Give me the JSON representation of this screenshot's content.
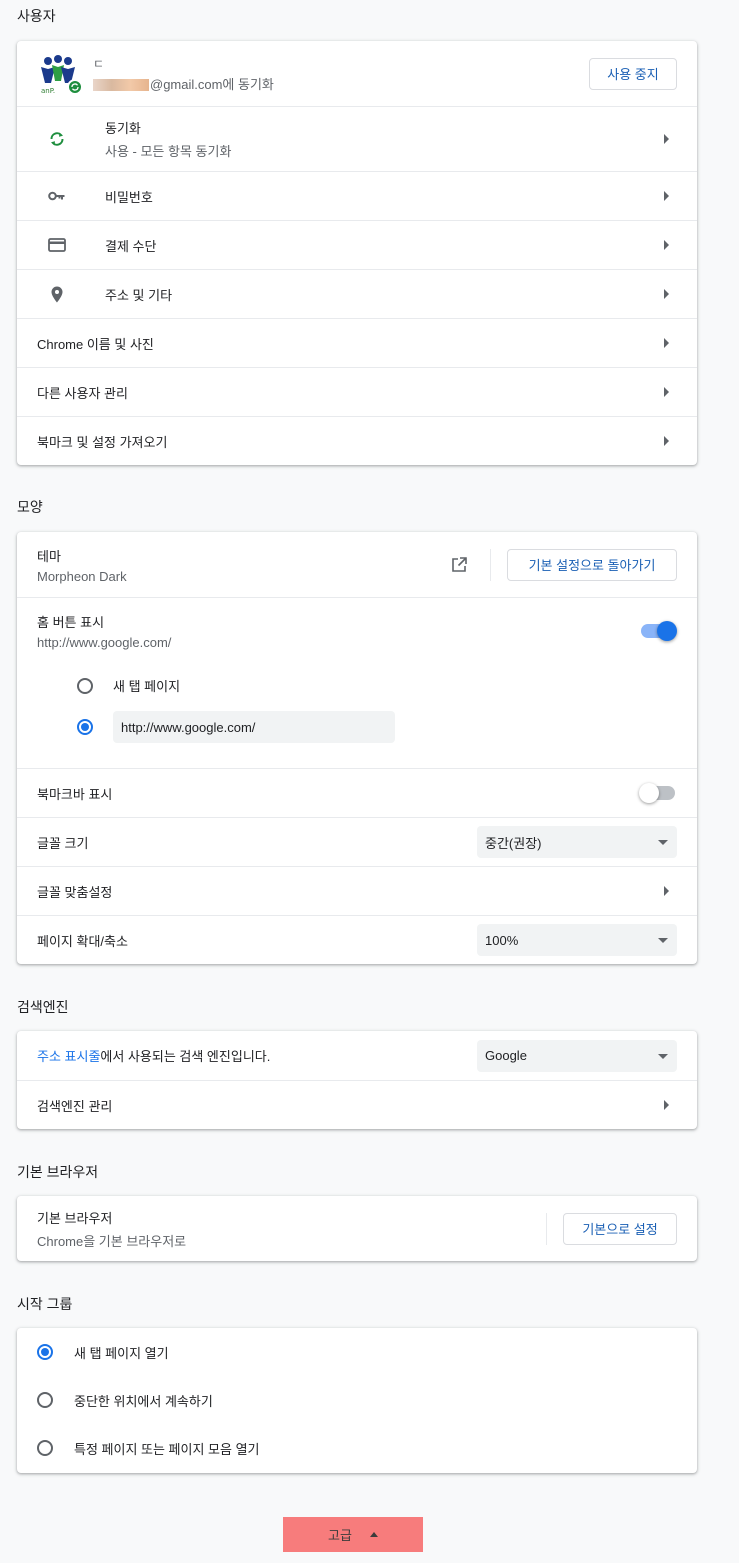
{
  "people": {
    "title": "사용자",
    "account": {
      "name": "ㄷ",
      "email": "@gmail.com에 동기화",
      "stop_button": "사용 중지"
    },
    "rows": [
      {
        "label": "동기화",
        "sub": "사용 - 모든 항목 동기화",
        "icon": "sync-icon"
      },
      {
        "label": "비밀번호",
        "icon": "key-icon"
      },
      {
        "label": "결제 수단",
        "icon": "credit-card-icon"
      },
      {
        "label": "주소 및 기타",
        "icon": "location-pin-icon"
      },
      {
        "label": "Chrome 이름 및 사진"
      },
      {
        "label": "다른 사용자 관리"
      },
      {
        "label": "북마크 및 설정 가져오기"
      }
    ]
  },
  "appearance": {
    "title": "모양",
    "theme": {
      "label": "테마",
      "value": "Morpheon Dark",
      "reset_button": "기본 설정으로 돌아가기"
    },
    "home_button": {
      "label": "홈 버튼 표시",
      "value": "http://www.google.com/",
      "enabled": true,
      "options": [
        "새 탭 페이지",
        "http://www.google.com/"
      ],
      "selected": 1,
      "custom_url": "http://www.google.com/"
    },
    "bookmarks_bar": {
      "label": "북마크바 표시",
      "enabled": false
    },
    "font_size": {
      "label": "글꼴 크기",
      "selected": "중간(권장)"
    },
    "customize_fonts": {
      "label": "글꼴 맞춤설정"
    },
    "page_zoom": {
      "label": "페이지 확대/축소",
      "selected": "100%"
    }
  },
  "search_engine": {
    "title": "검색엔진",
    "description_link": "주소 표시줄",
    "description_rest": "에서 사용되는 검색 엔진입니다.",
    "selected": "Google",
    "manage_label": "검색엔진 관리"
  },
  "default_browser": {
    "title": "기본 브라우저",
    "label": "기본 브라우저",
    "sub": "Chrome을 기본 브라우저로",
    "button": "기본으로 설정"
  },
  "on_startup": {
    "title": "시작 그룹",
    "options": [
      "새 탭 페이지 열기",
      "중단한 위치에서 계속하기",
      "특정 페이지 또는 페이지 모음 열기"
    ],
    "selected": 0
  },
  "advanced": {
    "label": "고급"
  },
  "colors": {
    "accent": "#1a73e8",
    "advanced_bg": "#f77c7c"
  }
}
